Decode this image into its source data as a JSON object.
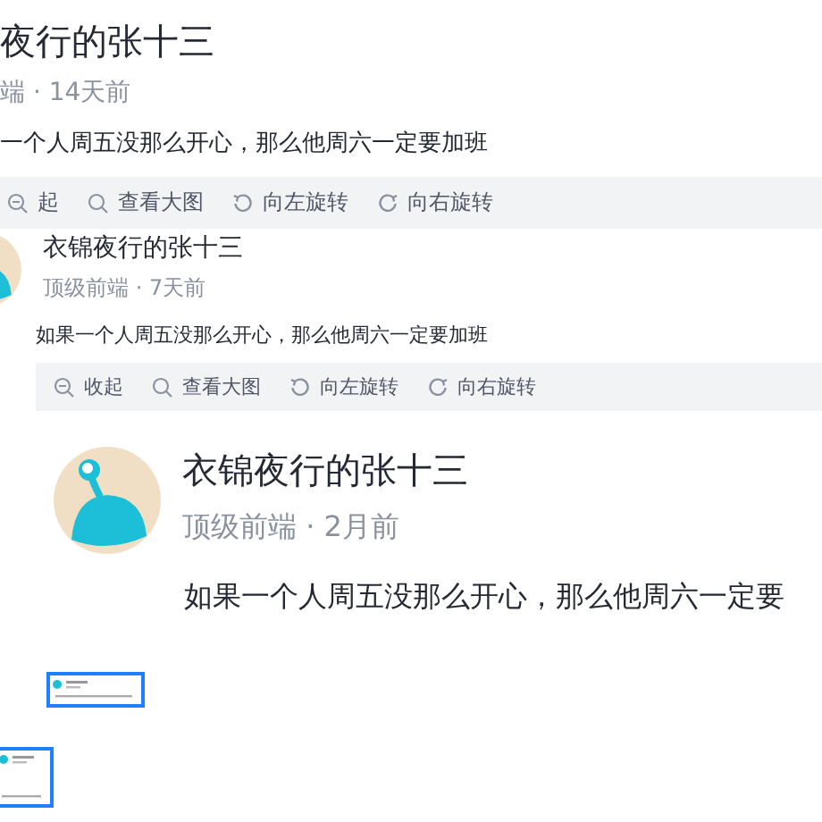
{
  "comments": [
    {
      "author": "夜行的张十三",
      "meta": "端 · 14天前",
      "body": "一个人周五没那么开心，那么他周六一定要加班",
      "actions": [
        {
          "kind": "collapse",
          "label": "起"
        },
        {
          "kind": "view",
          "label": "查看大图"
        },
        {
          "kind": "rotate-left",
          "label": "向左旋转"
        },
        {
          "kind": "rotate-right",
          "label": "向右旋转"
        }
      ]
    },
    {
      "author": "衣锦夜行的张十三",
      "meta": "顶级前端 · 7天前",
      "body": "如果一个人周五没那么开心，那么他周六一定要加班",
      "actions": [
        {
          "kind": "collapse",
          "label": "收起"
        },
        {
          "kind": "view",
          "label": "查看大图"
        },
        {
          "kind": "rotate-left",
          "label": "向左旋转"
        },
        {
          "kind": "rotate-right",
          "label": "向右旋转"
        }
      ]
    },
    {
      "author": "衣锦夜行的张十三",
      "meta": "顶级前端 · 2月前",
      "body": "如果一个人周五没那么开心，那么他周六一定要"
    }
  ]
}
